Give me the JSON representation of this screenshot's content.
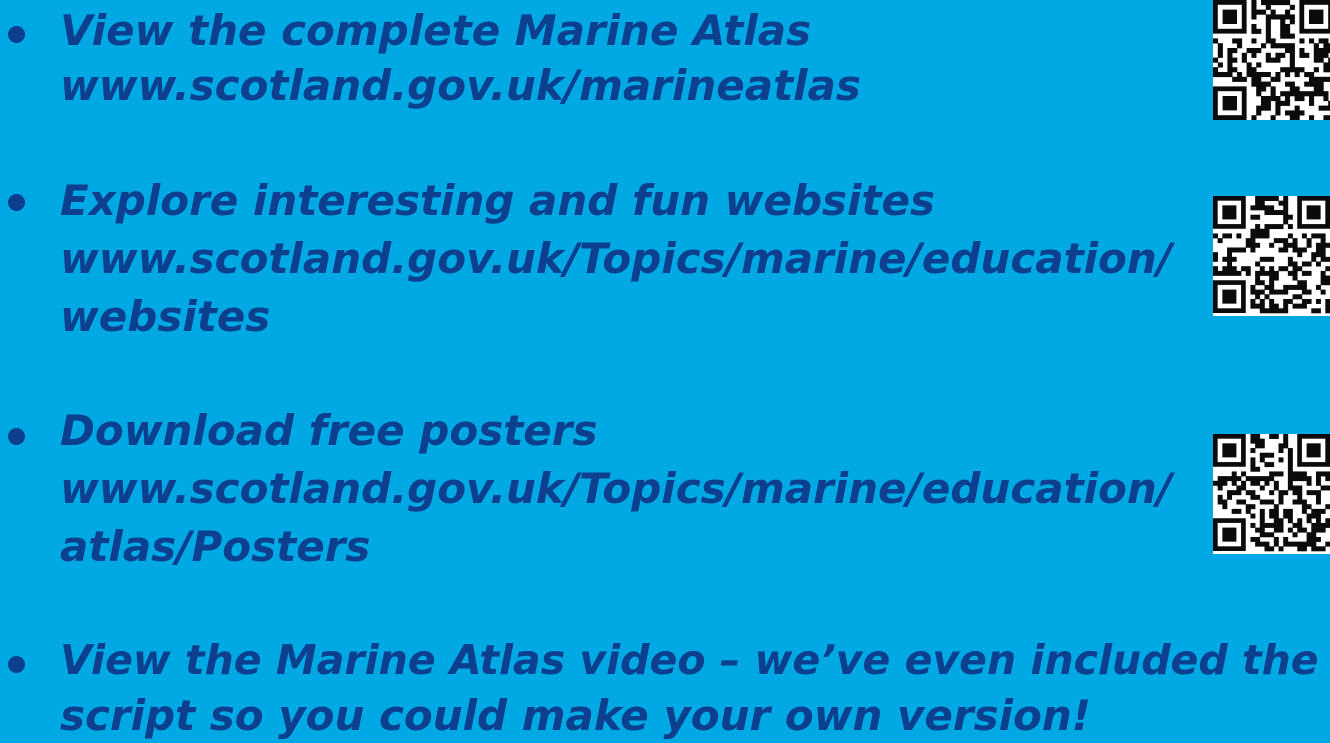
{
  "items": [
    {
      "title": "View the complete Marine Atlas",
      "url_line1": "www.scotland.gov.uk/marineatlas"
    },
    {
      "title": "Explore interesting and fun websites",
      "url_line1": "www.scotland.gov.uk/Topics/marine/education/",
      "url_line2": "websites"
    },
    {
      "title": "Download free posters",
      "url_line1": "www.scotland.gov.uk/Topics/marine/education/",
      "url_line2": "atlas/Posters"
    },
    {
      "title": "View the Marine Atlas video – we’ve even included the",
      "title_line2": "script so you could make your own version!"
    }
  ],
  "colors": {
    "background": "#00a8e4",
    "text": "#0d3f8f",
    "qr_dark": "#0b0b0b",
    "qr_light": "#ffffff"
  }
}
